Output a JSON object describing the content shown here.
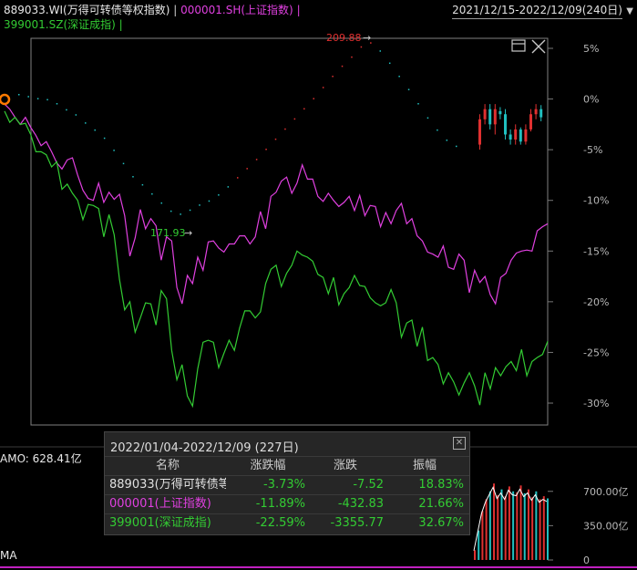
{
  "header": {
    "s1_label": "889033.WI(万得可转债等权指数)",
    "s2_label": "000001.SH(上证指数)",
    "s3_label": "399001.SZ(深证成指)",
    "separator": "|",
    "date_range": "2021/12/15-2022/12/09(240日)"
  },
  "colors": {
    "s1": "#d8d8d8",
    "s2": "#e040e0",
    "s3": "#33cc33",
    "up": "#e03030",
    "down": "#20c0c0",
    "axis": "#9a9a9a",
    "frame": "#808080"
  },
  "chart_data": [
    {
      "type": "line",
      "y_ticks": [
        "5%",
        "0%",
        "-5%",
        "-10%",
        "-15%",
        "-20%",
        "-25%",
        "-30%"
      ],
      "ylim": [
        -31,
        6
      ],
      "annotations": {
        "high": "209.88",
        "low": "171.93"
      },
      "series": [
        {
          "name": "000001.SH(上证指数)",
          "values": [
            -0.5,
            -1.0,
            -1.8,
            -2.5,
            -1.8,
            -2.8,
            -3.6,
            -4.6,
            -4.2,
            -5.2,
            -6.3,
            -6.9,
            -6.0,
            -5.8,
            -7.5,
            -9.0,
            -9.8,
            -10.0,
            -8.3,
            -10.2,
            -9.2,
            -9.9,
            -9.4,
            -11.5,
            -15.5,
            -13.7,
            -10.9,
            -12.8,
            -11.8,
            -12.5,
            -15.9,
            -13.6,
            -14.0,
            -18.6,
            -20.2,
            -17.4,
            -18.2,
            -15.6,
            -16.9,
            -14.1,
            -14.0,
            -14.7,
            -15.1,
            -14.3,
            -14.3,
            -13.5,
            -13.5,
            -14.3,
            -13.6,
            -11.1,
            -12.8,
            -9.6,
            -9.2,
            -8.1,
            -7.7,
            -9.3,
            -8.3,
            -6.5,
            -7.9,
            -7.9,
            -9.6,
            -10.1,
            -9.3,
            -10.0,
            -10.6,
            -10.2,
            -9.6,
            -11.0,
            -9.5,
            -11.5,
            -10.5,
            -10.6,
            -12.6,
            -11.2,
            -12.3,
            -11.0,
            -10.3,
            -12.3,
            -11.8,
            -13.5,
            -14.0,
            -15.1,
            -15.3,
            -15.6,
            -14.5,
            -16.6,
            -16.8,
            -15.3,
            -15.9,
            -19.1,
            -16.9,
            -18.1,
            -17.5,
            -19.3,
            -20.2,
            -17.6,
            -17.2,
            -15.9,
            -15.2,
            -15.0,
            -14.9,
            -15.0,
            -13.0,
            -12.6,
            -12.3
          ]
        },
        {
          "name": "399001.SZ(深证成指)",
          "values": [
            -1.2,
            -2.3,
            -1.8,
            -2.5,
            -2.4,
            -3.5,
            -5.2,
            -5.2,
            -5.5,
            -6.7,
            -6.2,
            -8.9,
            -8.4,
            -9.3,
            -10.0,
            -11.9,
            -10.4,
            -10.5,
            -10.8,
            -13.6,
            -11.4,
            -13.4,
            -17.8,
            -20.8,
            -20.0,
            -23.0,
            -21.6,
            -20.1,
            -20.2,
            -22.3,
            -18.9,
            -19.7,
            -24.8,
            -27.7,
            -26.2,
            -29.3,
            -30.3,
            -26.6,
            -24.0,
            -23.8,
            -24.0,
            -26.5,
            -25.1,
            -23.8,
            -24.8,
            -22.6,
            -20.9,
            -20.9,
            -21.6,
            -21.0,
            -18.2,
            -16.8,
            -16.4,
            -18.5,
            -17.2,
            -16.4,
            -15.0,
            -15.4,
            -15.6,
            -16.0,
            -17.3,
            -17.6,
            -19.2,
            -17.6,
            -20.3,
            -19.2,
            -18.6,
            -17.4,
            -18.4,
            -18.5,
            -19.6,
            -20.1,
            -20.4,
            -20.1,
            -18.8,
            -20.1,
            -23.5,
            -22.1,
            -21.8,
            -24.4,
            -22.5,
            -25.8,
            -25.5,
            -26.2,
            -28.1,
            -27.0,
            -27.9,
            -29.2,
            -28.0,
            -27.0,
            -28.3,
            -30.2,
            -27.0,
            -28.6,
            -26.5,
            -27.3,
            -26.4,
            -25.9,
            -26.8,
            -24.7,
            -27.3,
            -25.9,
            -25.5,
            -25.2,
            -23.9
          ]
        }
      ],
      "kline_dots": [
        0.5,
        0.3,
        0.1,
        0.0,
        -0.4,
        -1.0,
        -1.5,
        -2.3,
        -3.0,
        -3.8,
        -5.0,
        -6.3,
        -7.6,
        -8.4,
        -9.3,
        -10.2,
        -11.0,
        -11.3,
        -10.9,
        -10.4,
        -10.0,
        -9.4,
        -8.6,
        -7.7,
        -6.8,
        -5.9,
        -4.9,
        -3.9,
        -2.9,
        -1.9,
        -0.9,
        0.1,
        1.2,
        2.3,
        3.3,
        4.2,
        5.2,
        5.6,
        4.8,
        3.6,
        2.3,
        1.0,
        -0.4,
        -1.8,
        -3.0,
        -4.0,
        -4.6
      ],
      "kline_recent": [
        {
          "o": -4.5,
          "c": -2.0,
          "h": -1.5,
          "l": -5.0
        },
        {
          "o": -2.0,
          "c": -1.0,
          "h": -0.5,
          "l": -2.5
        },
        {
          "o": -1.0,
          "c": -2.5,
          "h": -0.5,
          "l": -3.0
        },
        {
          "o": -2.5,
          "c": -1.0,
          "h": -0.5,
          "l": -3.5
        },
        {
          "o": -1.2,
          "c": -1.5,
          "h": -0.8,
          "l": -2.0
        },
        {
          "o": -1.5,
          "c": -3.5,
          "h": -1.0,
          "l": -4.0
        },
        {
          "o": -3.5,
          "c": -4.0,
          "h": -3.0,
          "l": -4.5
        },
        {
          "o": -4.0,
          "c": -3.0,
          "h": -2.5,
          "l": -4.5
        },
        {
          "o": -3.0,
          "c": -4.2,
          "h": -2.8,
          "l": -4.5
        },
        {
          "o": -4.2,
          "c": -3.0,
          "h": -2.5,
          "l": -4.5
        },
        {
          "o": -3.0,
          "c": -1.5,
          "h": -1.0,
          "l": -3.2
        },
        {
          "o": -1.5,
          "c": -1.0,
          "h": -0.5,
          "l": -2.0
        },
        {
          "o": -1.0,
          "c": -1.8,
          "h": -0.6,
          "l": -2.2
        }
      ]
    },
    {
      "type": "bar",
      "title": "AMO: 628.41亿",
      "y_ticks": [
        "700.00亿",
        "350.00亿",
        "0"
      ],
      "ylim": [
        0,
        800
      ],
      "values": [
        100,
        300,
        500,
        620,
        700,
        780,
        660,
        720,
        650,
        750,
        700,
        690,
        760,
        680,
        720,
        640,
        700,
        620,
        650,
        628
      ]
    }
  ],
  "stats_table": {
    "title": "2022/01/04-2022/12/09 (227日)",
    "columns": [
      "名称",
      "涨跌幅",
      "涨跌",
      "振幅"
    ],
    "rows": [
      [
        "889033(万得可转债等",
        "-3.73%",
        "-7.52",
        "18.83%"
      ],
      [
        "000001(上证指数)",
        "-11.89%",
        "-432.83",
        "21.66%"
      ],
      [
        "399001(深证成指)",
        "-22.59%",
        "-3355.77",
        "32.67%"
      ]
    ]
  },
  "bottom_label": "MA"
}
